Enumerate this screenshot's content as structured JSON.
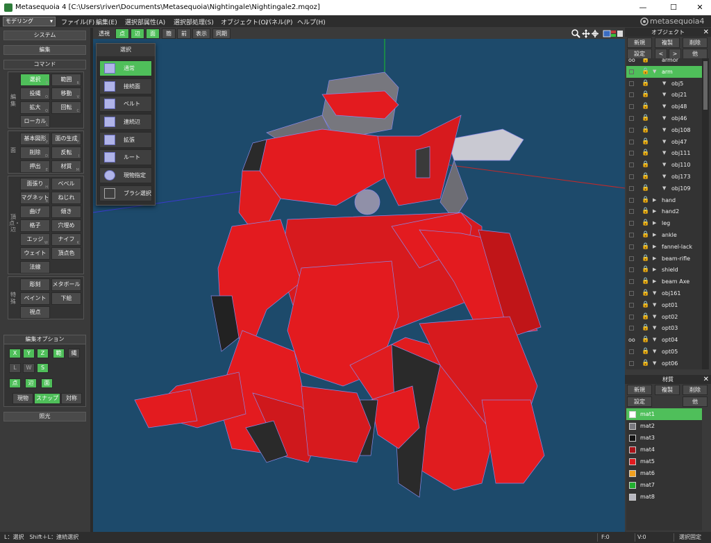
{
  "window": {
    "title": "Metasequoia 4 [C:\\Users\\river\\Documents\\Metasequoia\\Nightingale\\Nightingale2.mqoz]",
    "minimize": "—",
    "maximize": "☐",
    "close": "✕",
    "logo": "metasequoia4"
  },
  "mode": {
    "selected": "モデリング"
  },
  "menu": [
    "ファイル(F)",
    "編集(E)",
    "選択部属性(A)",
    "選択部処理(S)",
    "オブジェクト(O)",
    "パネル(P)",
    "ヘルプ(H)"
  ],
  "left": {
    "system": "システム",
    "edit": "編集",
    "command": "コマンド",
    "group_edit": "編集",
    "group_face": "面",
    "group_vertex": "頂点・辺",
    "group_special": "特殊",
    "edit_buttons": [
      {
        "label": "選択",
        "key": "S"
      },
      {
        "label": "範囲",
        "key": "R"
      },
      {
        "label": "投縄",
        "key": "O"
      },
      {
        "label": "移動",
        "key": "V"
      },
      {
        "label": "拡大",
        "key": "Q"
      },
      {
        "label": "回転",
        "key": "C"
      },
      {
        "label": "ローカル",
        "key": "L"
      }
    ],
    "face_buttons": [
      {
        "label": "基本図形",
        "key": "P"
      },
      {
        "label": "面の生成",
        "key": "F"
      },
      {
        "label": "削除",
        "key": "D"
      },
      {
        "label": "反転",
        "key": "I"
      },
      {
        "label": "押出",
        "key": "E"
      },
      {
        "label": "材質",
        "key": "M"
      }
    ],
    "vertex_buttons": [
      {
        "label": "面張り",
        "key": "H"
      },
      {
        "label": "ベベル",
        "key": ""
      },
      {
        "label": "マグネット",
        "key": "B"
      },
      {
        "label": "ねじれ",
        "key": ""
      },
      {
        "label": "曲げ",
        "key": ""
      },
      {
        "label": "傾き",
        "key": ""
      },
      {
        "label": "格子",
        "key": ""
      },
      {
        "label": "穴埋め",
        "key": ""
      },
      {
        "label": "エッジ",
        "key": "W"
      },
      {
        "label": "ナイフ",
        "key": "K"
      },
      {
        "label": "ウェイト",
        "key": ""
      },
      {
        "label": "頂点色",
        "key": ""
      },
      {
        "label": "法線",
        "key": ""
      }
    ],
    "special_buttons": [
      {
        "label": "彫刻",
        "key": ""
      },
      {
        "label": "メタボール",
        "key": ""
      },
      {
        "label": "ペイント",
        "key": ""
      },
      {
        "label": "下絵",
        "key": ""
      },
      {
        "label": "視点",
        "key": ""
      }
    ],
    "edit_options": "編集オプション",
    "axes": [
      "X",
      "Y",
      "Z"
    ],
    "axis_options": [
      "範",
      "縄"
    ],
    "sym": [
      "L",
      "W",
      "S"
    ],
    "elements": [
      "点",
      "辺",
      "面"
    ],
    "snap": [
      "現物",
      "スナップ",
      "対称"
    ],
    "lighting": "照光"
  },
  "toolbar": {
    "persp": "透視",
    "elements": [
      "点",
      "辺",
      "面"
    ],
    "extra": [
      "簡",
      "前",
      "表示",
      "同期"
    ]
  },
  "select_popup": {
    "title": "選択",
    "items": [
      "通常",
      "接続面",
      "ベルト",
      "連続辺",
      "拡張",
      "ルート",
      "現物指定",
      "ブラシ選択"
    ]
  },
  "objects": {
    "title": "オブジェクト",
    "buttons": [
      "新規",
      "複製",
      "削除"
    ],
    "buttons2": [
      "設定",
      "<",
      ">",
      "他"
    ],
    "rows": [
      {
        "name": "armor",
        "indent": 0,
        "arrow": "",
        "eye": "oo",
        "lock": true
      },
      {
        "name": "arm",
        "indent": 0,
        "arrow": "▼",
        "eye": "",
        "lock": true
      },
      {
        "name": "obj5",
        "indent": 1,
        "arrow": "▼",
        "eye": "",
        "lock": true
      },
      {
        "name": "obj21",
        "indent": 1,
        "arrow": "▼",
        "eye": "",
        "lock": true
      },
      {
        "name": "obj48",
        "indent": 1,
        "arrow": "▼",
        "eye": "",
        "lock": true
      },
      {
        "name": "obj46",
        "indent": 1,
        "arrow": "▼",
        "eye": "",
        "lock": true
      },
      {
        "name": "obj108",
        "indent": 1,
        "arrow": "▼",
        "eye": "",
        "lock": true
      },
      {
        "name": "obj47",
        "indent": 1,
        "arrow": "▼",
        "eye": "",
        "lock": true
      },
      {
        "name": "obj111",
        "indent": 1,
        "arrow": "▼",
        "eye": "",
        "lock": true
      },
      {
        "name": "obj110",
        "indent": 1,
        "arrow": "▼",
        "eye": "",
        "lock": true
      },
      {
        "name": "obj173",
        "indent": 1,
        "arrow": "▼",
        "eye": "",
        "lock": true
      },
      {
        "name": "obj109",
        "indent": 1,
        "arrow": "▼",
        "eye": "",
        "lock": true
      },
      {
        "name": "hand",
        "indent": 0,
        "arrow": "▶",
        "eye": "",
        "lock": true
      },
      {
        "name": "hand2",
        "indent": 0,
        "arrow": "▶",
        "eye": "",
        "lock": true
      },
      {
        "name": "leg",
        "indent": 0,
        "arrow": "▶",
        "eye": "",
        "lock": true
      },
      {
        "name": "ankle",
        "indent": 0,
        "arrow": "▶",
        "eye": "",
        "lock": true
      },
      {
        "name": "fannel-lack",
        "indent": 0,
        "arrow": "▶",
        "eye": "",
        "lock": true
      },
      {
        "name": "beam-rifle",
        "indent": 0,
        "arrow": "▶",
        "eye": "",
        "lock": true
      },
      {
        "name": "shield",
        "indent": 0,
        "arrow": "▶",
        "eye": "",
        "lock": true
      },
      {
        "name": "beam Axe",
        "indent": 0,
        "arrow": "▶",
        "eye": "",
        "lock": true
      },
      {
        "name": "obj161",
        "indent": 0,
        "arrow": "▼",
        "eye": "",
        "lock": true
      },
      {
        "name": "opt01",
        "indent": 0,
        "arrow": "▼",
        "eye": "",
        "lock": true
      },
      {
        "name": "opt02",
        "indent": 0,
        "arrow": "▼",
        "eye": "",
        "lock": true
      },
      {
        "name": "opt03",
        "indent": 0,
        "arrow": "▼",
        "eye": "",
        "lock": true
      },
      {
        "name": "opt04",
        "indent": 0,
        "arrow": "▼",
        "eye": "oo",
        "lock": true
      },
      {
        "name": "opt05",
        "indent": 0,
        "arrow": "▼",
        "eye": "",
        "lock": true
      },
      {
        "name": "opt06",
        "indent": 0,
        "arrow": "▼",
        "eye": "",
        "lock": true
      }
    ],
    "selected_index": 1
  },
  "materials": {
    "title": "材質",
    "buttons": [
      "新規",
      "複製",
      "削除"
    ],
    "buttons2": [
      "設定",
      "他"
    ],
    "rows": [
      {
        "name": "mat1",
        "color": "#ffffff"
      },
      {
        "name": "mat2",
        "color": "#7a7a80"
      },
      {
        "name": "mat3",
        "color": "#151515"
      },
      {
        "name": "mat4",
        "color": "#a8141a"
      },
      {
        "name": "mat5",
        "color": "#e31b1f"
      },
      {
        "name": "mat6",
        "color": "#f0a020"
      },
      {
        "name": "mat7",
        "color": "#22b030"
      },
      {
        "name": "mat8",
        "color": "#b8b8c0"
      }
    ],
    "selected_index": 0
  },
  "status": {
    "hint": "L：選択　Shift＋L：連続選択",
    "face_count": "F:0",
    "vertex_count": "V:0",
    "sel_lock": "選択固定"
  },
  "colors": {
    "accent": "#4fbf5a",
    "viewport_bg": "#1d4a6b",
    "model_red": "#e31b1f"
  }
}
